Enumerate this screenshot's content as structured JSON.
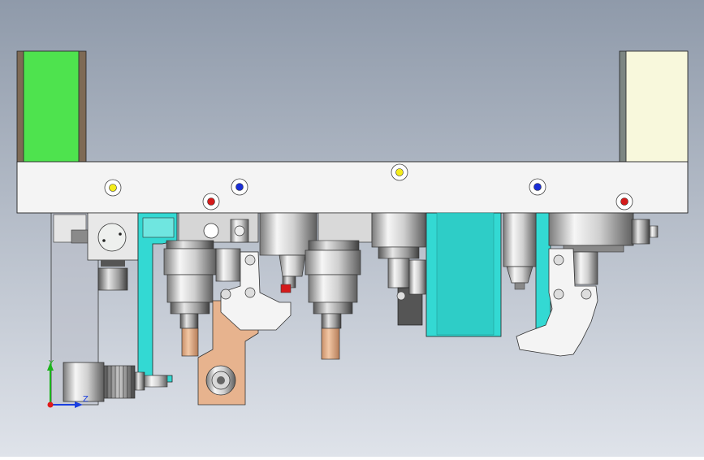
{
  "colors": {
    "background_top": "#8f9aaa",
    "background_bottom": "#dfe3ea",
    "plate": "#f4f4f4",
    "green_block": "#4ee34e",
    "cream_block": "#f8f8dc",
    "cyan_part": "#33d9d3",
    "copper": "#e7b38e",
    "marker_yellow": "#f4ec1a",
    "marker_blue": "#1b2fd6",
    "marker_red": "#d41a1a",
    "axis_x": "#1a3fe0",
    "axis_y": "#1ab31a",
    "axis_z": "#e01a1a"
  },
  "icons": {
    "triad": "coordinate-triad-icon"
  },
  "triad": {
    "x_label": "Z",
    "y_label": "Y"
  }
}
